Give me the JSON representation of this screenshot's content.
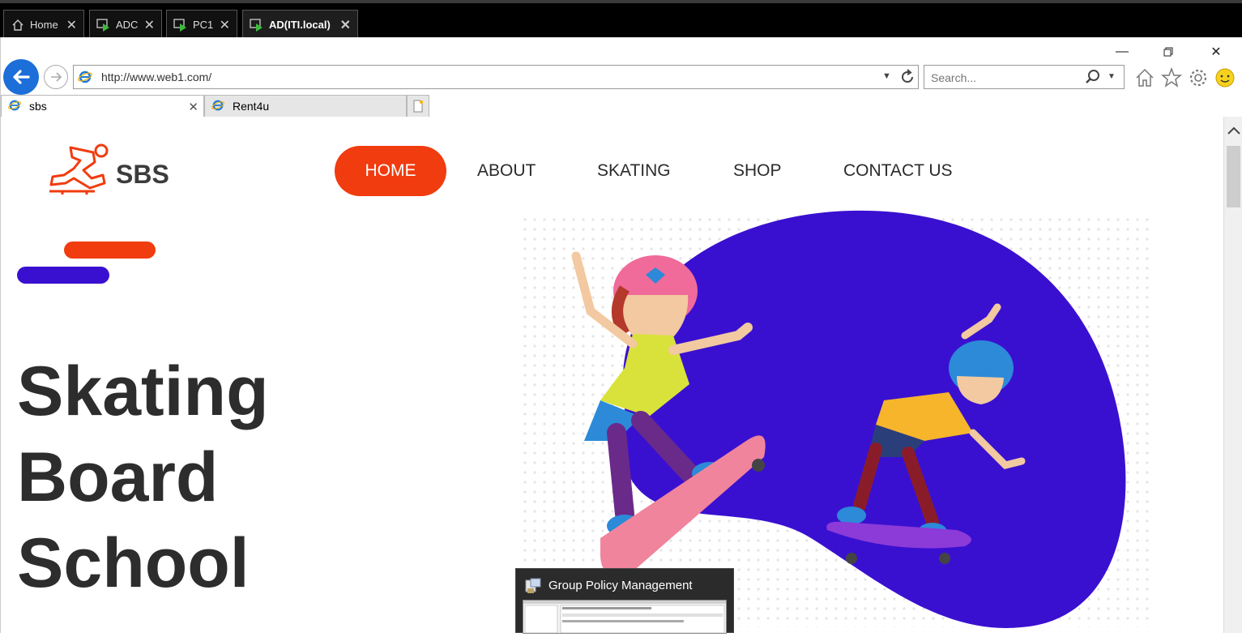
{
  "vm_tabs": [
    {
      "label": "Home",
      "icon": "home-icon"
    },
    {
      "label": "ADC",
      "icon": "vm-console-icon"
    },
    {
      "label": "PC1",
      "icon": "vm-console-icon"
    },
    {
      "label": "AD(ITI.local)",
      "icon": "vm-console-icon"
    }
  ],
  "browser": {
    "address": "http://www.web1.com/",
    "search_placeholder": "Search...",
    "tabs": [
      {
        "label": "sbs"
      },
      {
        "label": "Rent4u"
      }
    ]
  },
  "site": {
    "logo_text": "SBS",
    "nav": [
      "HOME",
      "ABOUT",
      "SKATING",
      "SHOP",
      "CONTACT US"
    ],
    "hero_lines": [
      "Skating",
      "Board",
      "School"
    ],
    "colors": {
      "accent_red": "#f03c0f",
      "accent_blue": "#3a10d0"
    }
  },
  "taskbar_popup": {
    "title": "Group Policy Management"
  }
}
